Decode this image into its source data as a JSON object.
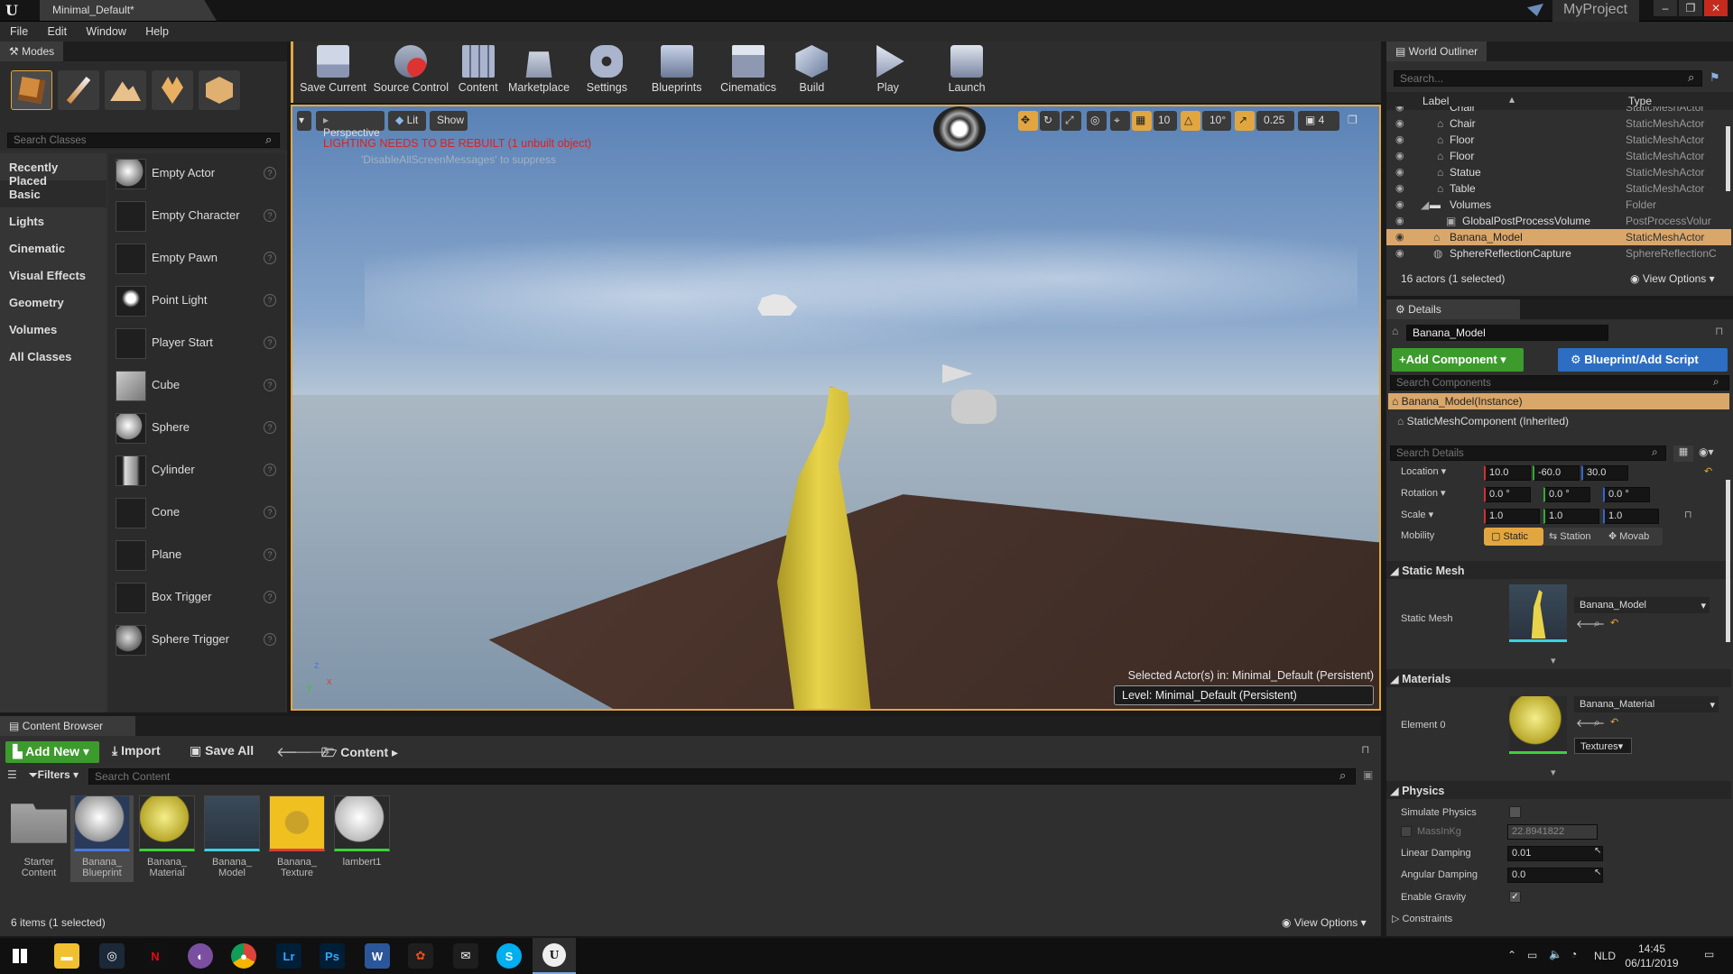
{
  "titlebar": {
    "doc_tab": "Minimal_Default*",
    "project": "MyProject"
  },
  "menu": {
    "items": [
      "File",
      "Edit",
      "Window",
      "Help"
    ]
  },
  "modes": {
    "tab": "Modes",
    "search_placeholder": "Search Classes",
    "categories": [
      "Recently Placed",
      "Basic",
      "Lights",
      "Cinematic",
      "Visual Effects",
      "Geometry",
      "Volumes",
      "All Classes"
    ],
    "selected_category": "Basic",
    "classes": [
      "Empty Actor",
      "Empty Character",
      "Empty Pawn",
      "Point Light",
      "Player Start",
      "Cube",
      "Sphere",
      "Cylinder",
      "Cone",
      "Plane",
      "Box Trigger",
      "Sphere Trigger"
    ]
  },
  "toolbar": {
    "buttons": [
      "Save Current",
      "Source Control",
      "Content",
      "Marketplace",
      "Settings",
      "Blueprints",
      "Cinematics",
      "Build",
      "Play",
      "Launch"
    ]
  },
  "viewport": {
    "perspective": "Perspective",
    "lit": "Lit",
    "show": "Show",
    "warning": "LIGHTING NEEDS TO BE REBUILT (1 unbuilt object)",
    "warning_hint": "'DisableAllScreenMessages' to suppress",
    "grid_snap": "10",
    "rot_snap": "10°",
    "scale_snap": "0.25",
    "cam_speed": "4",
    "selected_in": "Selected Actor(s) in:  Minimal_Default (Persistent)",
    "level": "Level:  Minimal_Default (Persistent)"
  },
  "outliner": {
    "tab": "World Outliner",
    "search_placeholder": "Search...",
    "col_label": "Label",
    "col_type": "Type",
    "rows": [
      {
        "label": "Chair",
        "type": "StaticMeshActor"
      },
      {
        "label": "Chair",
        "type": "StaticMeshActor"
      },
      {
        "label": "Floor",
        "type": "StaticMeshActor"
      },
      {
        "label": "Floor",
        "type": "StaticMeshActor"
      },
      {
        "label": "Statue",
        "type": "StaticMeshActor"
      },
      {
        "label": "Table",
        "type": "StaticMeshActor"
      },
      {
        "label": "Volumes",
        "type": "Folder"
      },
      {
        "label": "GlobalPostProcessVolume",
        "type": "PostProcessVolur"
      },
      {
        "label": "Banana_Model",
        "type": "StaticMeshActor"
      },
      {
        "label": "SphereReflectionCapture",
        "type": "SphereReflectionC"
      }
    ],
    "status": "16 actors (1 selected)",
    "view_options": "View Options"
  },
  "details": {
    "tab": "Details",
    "name": "Banana_Model",
    "add_component": "Add Component",
    "blueprint": "Blueprint/Add Script",
    "search_components": "Search Components",
    "instance": "Banana_Model(Instance)",
    "component": "StaticMeshComponent (Inherited)",
    "search_details": "Search Details",
    "transform": {
      "location_label": "Location",
      "location": [
        "10.0",
        "-60.0",
        "30.0"
      ],
      "rotation_label": "Rotation",
      "rotation": [
        "0.0 °",
        "0.0 °",
        "0.0 °"
      ],
      "scale_label": "Scale",
      "scale": [
        "1.0",
        "1.0",
        "1.0"
      ],
      "mobility_label": "Mobility",
      "mobility": [
        "Static",
        "Station",
        "Movab"
      ]
    },
    "static_mesh_section": "Static Mesh",
    "static_mesh_label": "Static Mesh",
    "static_mesh_value": "Banana_Model",
    "materials_section": "Materials",
    "element_label": "Element 0",
    "material_value": "Banana_Material",
    "textures": "Textures",
    "physics_section": "Physics",
    "simulate_physics": "Simulate Physics",
    "mass_label": "MassInKg",
    "mass_value": "22.8941822",
    "linear_damping_label": "Linear Damping",
    "linear_damping": "0.01",
    "angular_damping_label": "Angular Damping",
    "angular_damping": "0.0",
    "enable_gravity": "Enable Gravity",
    "constraints": "Constraints"
  },
  "content_browser": {
    "tab": "Content Browser",
    "add_new": "Add New",
    "import": "Import",
    "save_all": "Save All",
    "path": "Content",
    "filters": "Filters",
    "search_placeholder": "Search Content",
    "assets": [
      {
        "name": "Starter Content"
      },
      {
        "name": "Banana_ Blueprint"
      },
      {
        "name": "Banana_ Material"
      },
      {
        "name": "Banana_ Model"
      },
      {
        "name": "Banana_ Texture"
      },
      {
        "name": "lambert1"
      }
    ],
    "status": "6 items (1 selected)",
    "view_options": "View Options"
  },
  "taskbar": {
    "lang": "NLD",
    "time": "14:45",
    "date": "06/11/2019"
  },
  "colors": {
    "accent_orange": "#e2a641",
    "add_green": "#3c9b2c",
    "blueprint_blue": "#2d6ec2",
    "warning_red": "#e0201c"
  }
}
